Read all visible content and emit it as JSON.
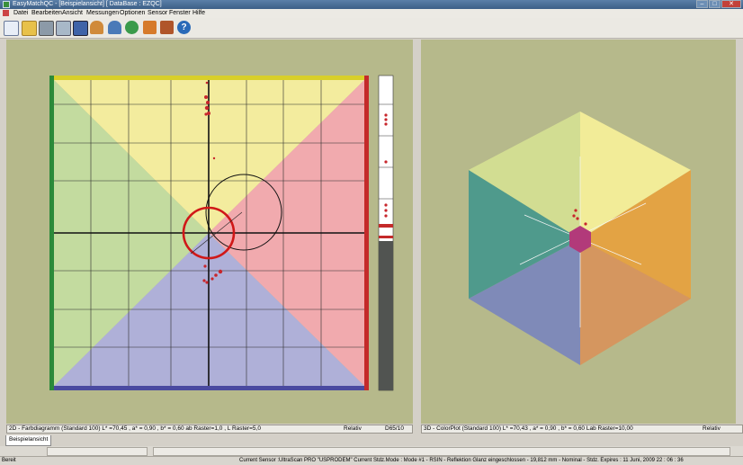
{
  "window": {
    "title": "EasyMatchQC - [Beispielansicht]   [ DataBase : EZQC]",
    "buttons": {
      "minimize": "–",
      "maximize": "□",
      "close": "✕"
    }
  },
  "menu": [
    "Datei",
    "Bearbeiten",
    "Ansicht",
    "Messungen",
    "Optionen",
    "Sensor",
    "Fenster",
    "Hilfe"
  ],
  "toolbar": [
    {
      "icon": "new-document-icon",
      "color": "#e8eef7"
    },
    {
      "icon": "open-folder-icon",
      "color": "#e8c14a"
    },
    {
      "icon": "print-icon",
      "color": "#8c9aa8"
    },
    {
      "icon": "print-preview-icon",
      "color": "#a8b8c8"
    },
    {
      "icon": "save-icon",
      "color": "#3f63a8"
    },
    {
      "icon": "user-icon",
      "color": "#d08a3a"
    },
    {
      "icon": "users-icon",
      "color": "#4a7ab8"
    },
    {
      "icon": "measure-icon",
      "color": "#3a9a4a"
    },
    {
      "icon": "sensor-icon",
      "color": "#d67a2a"
    },
    {
      "icon": "book-icon",
      "color": "#b0552a"
    },
    {
      "icon": "help-icon",
      "color": "#2a6ab8"
    }
  ],
  "left_pane": {
    "info": "2D - Farbdiagramm (Standard 100)  L* =70,45 ,  a* = 0,90 ,  b* = 0,60     ab Raster=1,0 , L Raster=5,0",
    "mode": "Relativ",
    "illuminant": "D65/10"
  },
  "right_pane": {
    "info": "3D - ColorPlot (Standard 100)  L* =70,43 ,  a* = 0,90 ,  b* = 0,60     Lab Raster=10,00",
    "mode": "Relativ"
  },
  "tab": "Beispielansicht",
  "status": {
    "ready": "Bereit",
    "sensor": "Current Sensor :UltraScan PRO \"USPRODEM\"   Current Stdz.Mode :  Mode #1 - RSIN - Reflektion Glanz eingeschlossen - 19,812 mm - Nominal -  Stdz. Expires : 11 Juni, 2009 22 : 06 : 36"
  },
  "colors": {
    "yellow": "#f3ec9e",
    "red": "#f1aaae",
    "blue": "#afb0d8",
    "green": "#c3db9f",
    "pane_bg": "#b6b98b",
    "sample": "#c8262c"
  }
}
